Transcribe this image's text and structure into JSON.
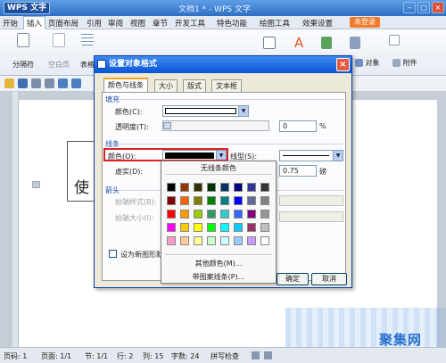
{
  "app": {
    "logo": "WPS 文字",
    "window_title": "文档1 * - WPS 文字"
  },
  "menu": {
    "items": [
      "开始",
      "插入",
      "页面布局",
      "引用",
      "审阅",
      "视图",
      "章节",
      "开发工具",
      "特色功能",
      "绘图工具",
      "效果设置"
    ],
    "active": "插入",
    "login": "未登录"
  },
  "ribbon": {
    "page_break": "分隔符",
    "blank_page": "空白页",
    "table": "表格",
    "object": "对象",
    "attachment": "附件"
  },
  "document": {
    "textbox_text": "使"
  },
  "dialog": {
    "title": "设置对象格式",
    "tabs": [
      "颜色与线条",
      "大小",
      "版式",
      "文本框"
    ],
    "active_tab": "颜色与线条",
    "fill_section": "填充",
    "fill_color_label": "颜色(C):",
    "transparency_label": "透明度(T):",
    "transparency_value": "0",
    "transparency_unit": "%",
    "line_section": "线条",
    "line_color_label": "颜色(O):",
    "line_style_label": "线型(S):",
    "dash_label": "虚实(D):",
    "weight_value": "0.75",
    "weight_unit": "磅",
    "arrows_section": "箭头",
    "begin_style_label": "始端样式(B):",
    "begin_size_label": "始端大小(I):",
    "default_checkbox_label": "设为新图形默认",
    "ok_label": "确定",
    "cancel_label": "取消"
  },
  "palette": {
    "no_line": "无线条颜色",
    "more_colors": "其他颜色(M)...",
    "pattern_line": "带图案线条(P)...",
    "colors": [
      "#000000",
      "#993300",
      "#333300",
      "#003300",
      "#003366",
      "#000080",
      "#333399",
      "#333333",
      "#800000",
      "#ff6600",
      "#808000",
      "#008000",
      "#008080",
      "#0000ff",
      "#666699",
      "#808080",
      "#ff0000",
      "#ff9900",
      "#99cc00",
      "#339966",
      "#33cccc",
      "#3366ff",
      "#800080",
      "#969696",
      "#ff00ff",
      "#ffcc00",
      "#ffff00",
      "#00ff00",
      "#00ffff",
      "#00ccff",
      "#993366",
      "#c0c0c0",
      "#ff99cc",
      "#ffcc99",
      "#ffff99",
      "#ccffcc",
      "#ccffff",
      "#99ccff",
      "#cc99ff",
      "#ffffff"
    ]
  },
  "statusbar": {
    "page": "页码: 1",
    "pages": "页面: 1/1",
    "section": "节: 1/1",
    "row": "行: 2",
    "column": "列: 15",
    "chars": "字数: 24",
    "spellcheck": "拼写检查"
  },
  "watermark": "聚集网"
}
